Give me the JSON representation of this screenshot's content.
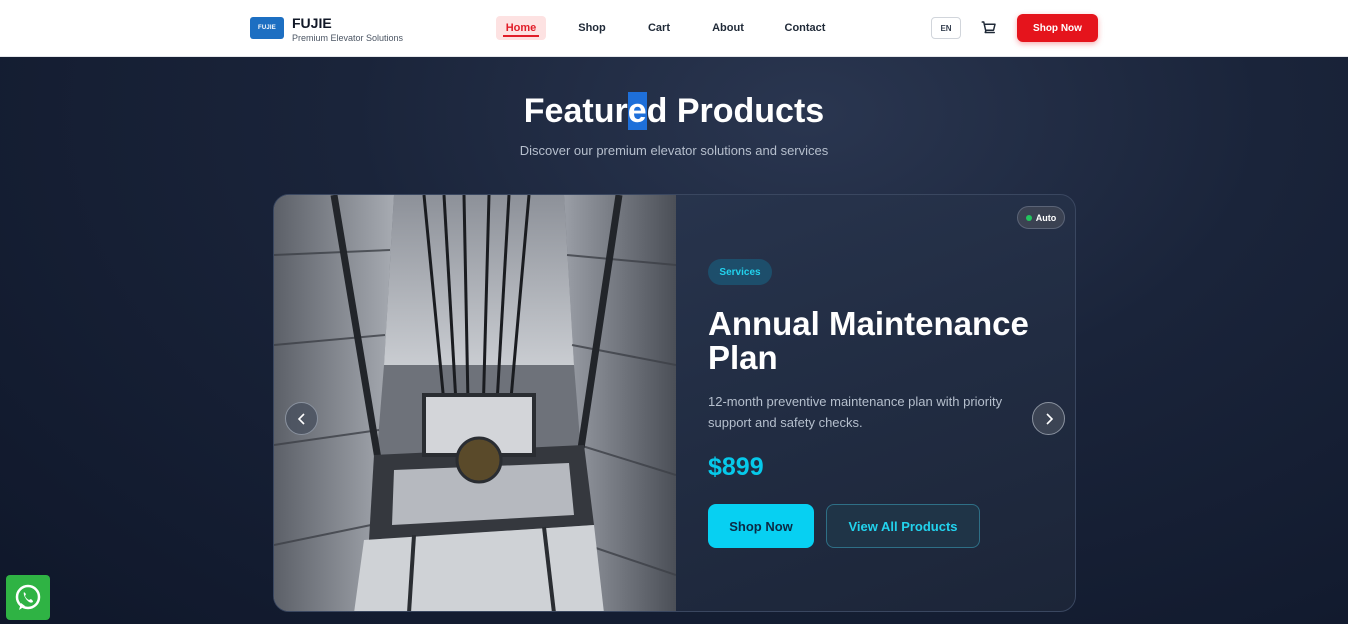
{
  "header": {
    "logo_text": "FUJIE",
    "brand": "FUJIE",
    "tagline": "Premium Elevator Solutions",
    "nav": [
      {
        "label": "Home",
        "active": true
      },
      {
        "label": "Shop"
      },
      {
        "label": "Cart"
      },
      {
        "label": "About"
      },
      {
        "label": "Contact"
      }
    ],
    "lang": "EN",
    "cart_icon": "cart-icon",
    "shop_button": "Shop Now"
  },
  "section": {
    "title_before": "Featur",
    "title_selected": "e",
    "title_after": "d Products",
    "subtitle": "Discover our premium elevator solutions and services"
  },
  "product": {
    "auto_label": "Auto",
    "tag": "Services",
    "title": "Annual Maintenance Plan",
    "description": "12-month preventive maintenance plan with priority support and safety checks.",
    "price": "$899",
    "primary_button": "Shop Now",
    "secondary_button": "View All Products",
    "image_alt": "elevator-shaft-photo"
  },
  "colors": {
    "accent_red": "#e5141c",
    "accent_cyan": "#07d0f2",
    "background": "#141d31",
    "whatsapp": "#2fb344"
  }
}
